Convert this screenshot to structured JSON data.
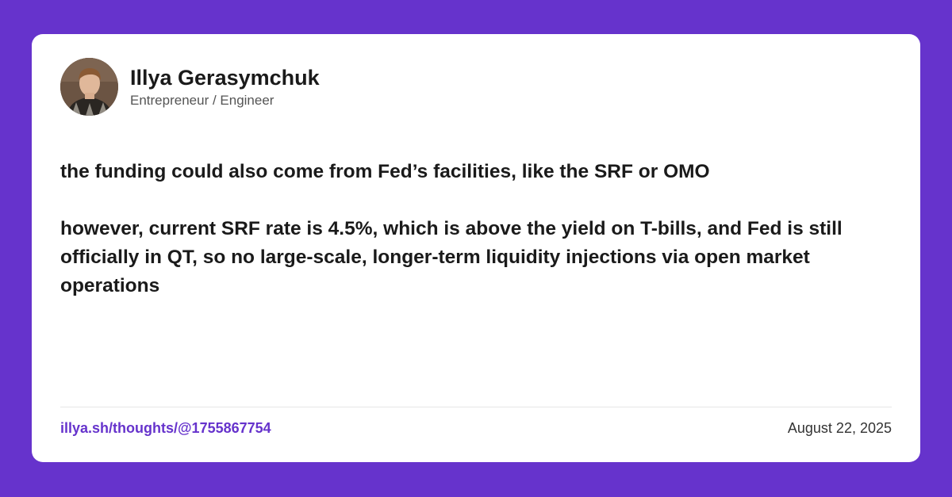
{
  "colors": {
    "background": "#6633cc",
    "card": "#ffffff",
    "accent": "#6633cc",
    "text": "#1a1a1a",
    "muted": "#555555"
  },
  "author": {
    "name": "Illya Gerasymchuk",
    "role": "Entrepreneur / Engineer",
    "avatar_icon": "profile-photo"
  },
  "post": {
    "paragraphs": [
      "the funding could also come from Fed’s facilities, like the SRF or OMO",
      "however, current SRF rate is 4.5%, which is above the yield on T-bills, and Fed is still officially in QT, so no large-scale, longer-term liquidity injections via open market operations"
    ]
  },
  "footer": {
    "link": "illya.sh/thoughts/@1755867754",
    "date": "August 22, 2025"
  }
}
